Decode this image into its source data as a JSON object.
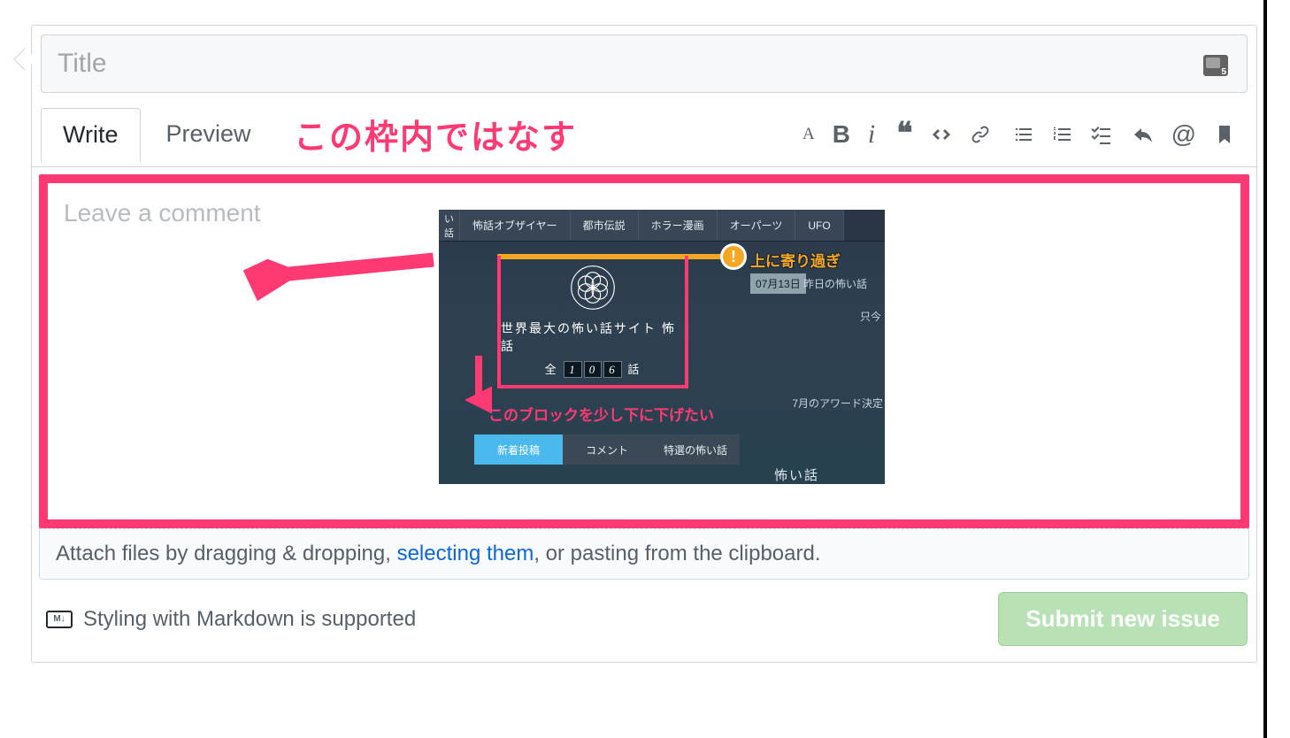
{
  "title": {
    "placeholder": "Title"
  },
  "tabs": {
    "write": "Write",
    "preview": "Preview"
  },
  "annotation_top": "この枠内ではなす",
  "comment": {
    "placeholder": "Leave a comment"
  },
  "attach": {
    "pre": "Attach files by dragging & dropping, ",
    "link": "selecting them",
    "post": ", or pasting from the clipboard."
  },
  "markdown_note": "Styling with Markdown is supported",
  "submit": "Submit new issue",
  "embedded": {
    "nav": [
      "い話",
      "怖話オブザイヤー",
      "都市伝説",
      "ホラー漫画",
      "オーパーツ",
      "UFO"
    ],
    "orange_badge": "!",
    "orange_label": "上に寄り過ぎ",
    "date": "07月13日",
    "date_text": "昨日の怖い話",
    "right1": "只今",
    "right2": "7月のアワード決定",
    "site_title": "世界最大の怖い話サイト 怖話",
    "counter_pre": "全",
    "counter_digits": [
      "1",
      "0",
      "6"
    ],
    "counter_post": "話",
    "pink_caption": "このブロックを少し下に下げたい",
    "bottom_tabs": [
      "新着投稿",
      "コメント",
      "特選の怖い話"
    ],
    "footer_label": "怖い話"
  }
}
